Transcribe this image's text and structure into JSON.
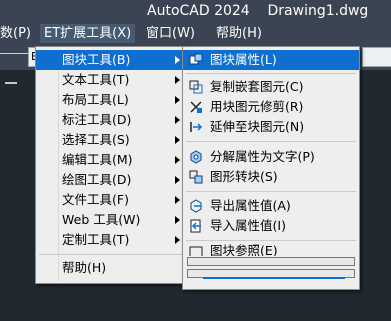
{
  "window": {
    "title": "AutoCAD 2024    Drawing1.dwg"
  },
  "menubar": [
    {
      "label": "数(P)"
    },
    {
      "label": "ET扩展工具(X)"
    },
    {
      "label": "窗口(W)"
    },
    {
      "label": "帮助(H)"
    }
  ],
  "toolbar": {
    "dropdown_text": "B"
  },
  "menu1": {
    "items": [
      {
        "label": "图块工具(B)"
      },
      {
        "label": "文本工具(T)"
      },
      {
        "label": "布局工具(L)"
      },
      {
        "label": "标注工具(D)"
      },
      {
        "label": "选择工具(S)"
      },
      {
        "label": "编辑工具(M)"
      },
      {
        "label": "绘图工具(D)"
      },
      {
        "label": "文件工具(F)"
      },
      {
        "label": "Web 工具(W)"
      },
      {
        "label": "定制工具(T)"
      },
      {
        "label": "帮助(H)"
      }
    ]
  },
  "menu2": {
    "items": [
      {
        "label": "图块属性(L)",
        "icon": "block-attribute-icon"
      },
      {
        "label": "复制嵌套图元(C)",
        "icon": "copy-nested-icon"
      },
      {
        "label": "用块图元修剪(R)",
        "icon": "trim-block-icon"
      },
      {
        "label": "延伸至块图元(N)",
        "icon": "extend-block-icon"
      },
      {
        "label": "分解属性为文字(P)",
        "icon": "explode-attribute-icon"
      },
      {
        "label": "图形转块(S)",
        "icon": "convert-block-icon"
      },
      {
        "label": "导出属性值(A)",
        "icon": "export-attribute-icon"
      },
      {
        "label": "导入属性值(I)",
        "icon": "import-attribute-icon"
      },
      {
        "label": "图块参照(E)",
        "icon": "block-reference-icon"
      }
    ]
  },
  "colors": {
    "highlight": "#0e6fd0",
    "menu_bg": "#eeeeee",
    "app_bg": "#3b4453",
    "canvas": "#212830"
  }
}
